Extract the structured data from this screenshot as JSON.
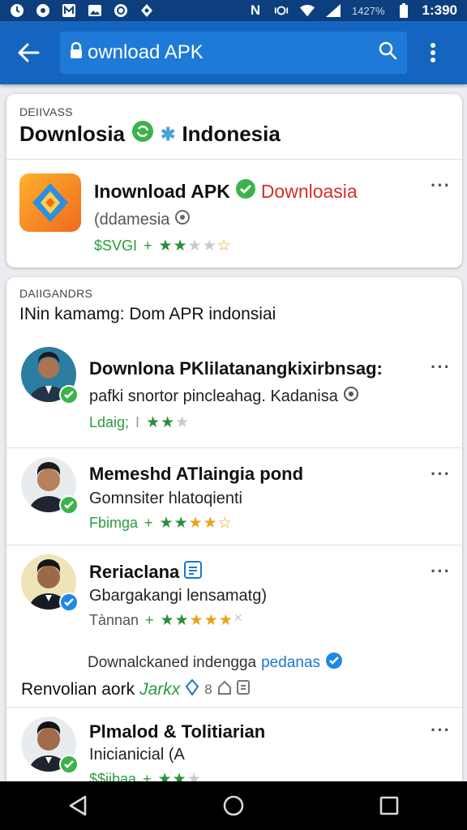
{
  "status_bar": {
    "battery_text": "1427%",
    "time": "1:390"
  },
  "app_bar": {
    "url_text": "ownload APK"
  },
  "card1": {
    "label": "DEIIVASS",
    "title_a": "Downlosia",
    "title_b": "Indonesia",
    "app": {
      "name": "Inownload APK",
      "name_red": "Downloasia",
      "sub": "(ddamesia",
      "meta": "$SVGI",
      "rating": 2.5
    }
  },
  "card2": {
    "label": "DAIIGANDRS",
    "heading": "INin kamamg: Dom APR indonsiai",
    "items": [
      {
        "title": "Downlona PKlilatanangkixirbnsag:",
        "sub": "pafki snortor pincleahag. Kadanisa",
        "meta": "Ldaig;",
        "sep": "I",
        "rating": 2
      },
      {
        "title": "Memeshd ATlaingia pond",
        "sub": "Gomnsiter hlatoqienti",
        "meta": "Fbimga",
        "sep": "+",
        "rating": 4
      },
      {
        "title": "Reriaclana",
        "sub": "Gbargakangi lensamatg)",
        "meta": "Tànnan",
        "sep": "+",
        "rating": 4
      },
      {
        "title": "Plmalod & Tolitiarian",
        "sub": "Inicianicial (A",
        "meta": "$$iibaa",
        "sep": "+",
        "rating": 2
      }
    ],
    "promo": {
      "line1": "Downalckaned indengga",
      "line1_blue": "pedanas",
      "line2": "Renvolian aork",
      "line2_green": "Jarkx",
      "line2_tail": "8"
    }
  },
  "colors": {
    "app_bar": "#1565c0",
    "status_bar": "#0d3f7e",
    "accent_green": "#2a9d3a",
    "accent_red": "#d32f2f",
    "accent_blue": "#1976d2"
  }
}
